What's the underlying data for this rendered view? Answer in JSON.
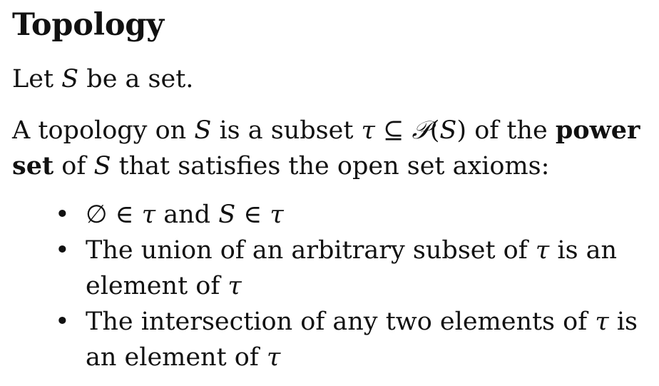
{
  "title": "Topology",
  "intro": {
    "let": "Let",
    "set_var": "S",
    "be_a_set": "be a set."
  },
  "definition": {
    "part1": "A topology on",
    "var_s": "S",
    "part2": "is a subset",
    "tau": "τ",
    "subseteq": "⊆",
    "powerset_symbol": "𝒫",
    "paren_open": "(",
    "paren_close": ")",
    "part3": "of the",
    "power_set_term": "power set",
    "part4": "of",
    "part5": "that satisfies the open set axioms:"
  },
  "axioms": {
    "bullet": "•",
    "item1": {
      "emptyset": "∅",
      "in": "∈",
      "tau": "τ",
      "and": "and",
      "var_s": "S"
    },
    "item2": {
      "text": "The union of an arbitrary subset of",
      "tau": "τ",
      "text2": "is an element of"
    },
    "item3": {
      "text": "The intersection of any two elements of",
      "tau": "τ",
      "text2": "is an element of"
    }
  }
}
